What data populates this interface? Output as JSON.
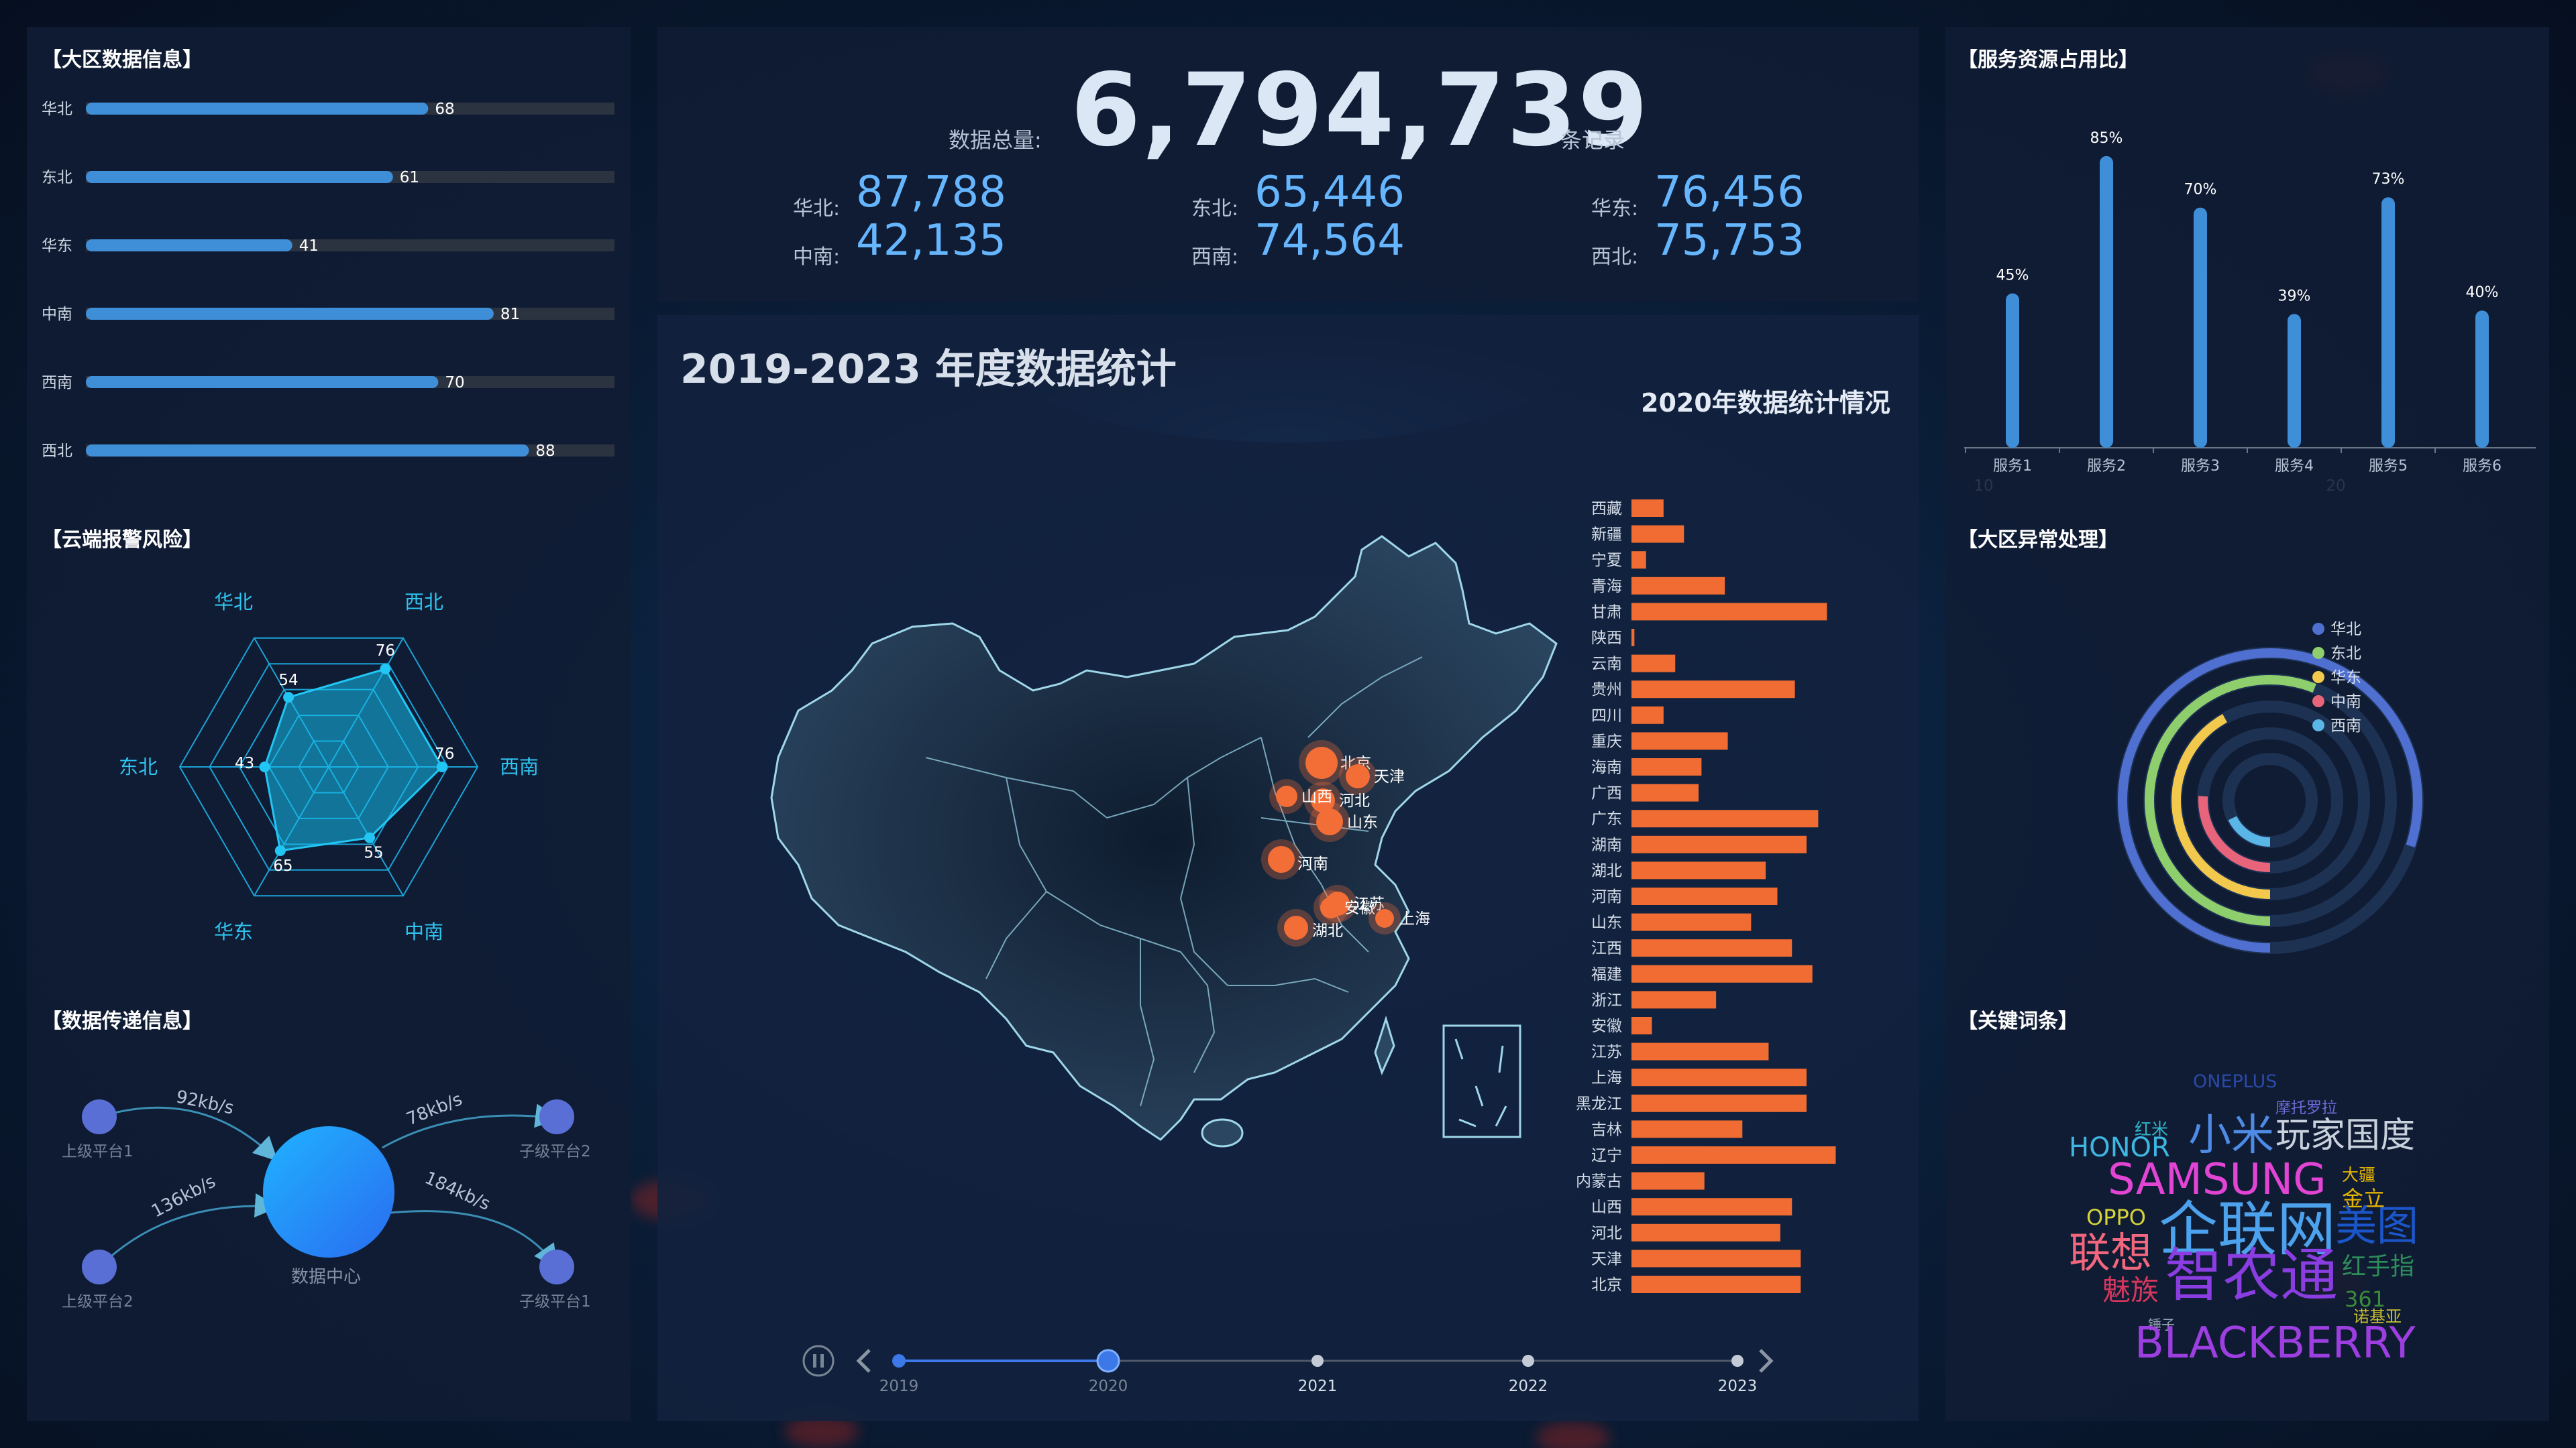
{
  "region_info": {
    "title": "【大区数据信息】",
    "chart_data": {
      "type": "bar",
      "orientation": "horizontal",
      "categories": [
        "华北",
        "东北",
        "华东",
        "中南",
        "西南",
        "西北"
      ],
      "values": [
        68,
        61,
        41,
        81,
        70,
        88
      ],
      "xlim": [
        0,
        105
      ]
    }
  },
  "cloud_risk": {
    "title": "【云端报警风险】",
    "chart_data": {
      "type": "radar",
      "indicators": [
        "华北",
        "西北",
        "西南",
        "中南",
        "华东",
        "东北"
      ],
      "values": [
        54,
        76,
        76,
        55,
        65,
        43
      ],
      "max": 100
    }
  },
  "data_transfer": {
    "title": "【数据传递信息】",
    "center_label": "数据中心",
    "nodes": [
      {
        "label": "上级平台1",
        "speed": "92kb/s"
      },
      {
        "label": "上级平台2",
        "speed": "136kb/s"
      },
      {
        "label": "子级平台2",
        "speed": "78kb/s"
      },
      {
        "label": "子级平台1",
        "speed": "184kb/s"
      }
    ]
  },
  "summary": {
    "total_label": "数据总量:",
    "total_value": "6,794,739",
    "total_unit": "条记录",
    "regions": [
      {
        "label": "华北:",
        "value": "87,788"
      },
      {
        "label": "东北:",
        "value": "65,446"
      },
      {
        "label": "华东:",
        "value": "76,456"
      },
      {
        "label": "中南:",
        "value": "42,135"
      },
      {
        "label": "西南:",
        "value": "74,564"
      },
      {
        "label": "西北:",
        "value": "75,753"
      }
    ]
  },
  "annual": {
    "title": "2019-2023 年度数据统计",
    "chart_title": "2020年数据统计情况",
    "map_points": [
      {
        "name": "北京"
      },
      {
        "name": "天津"
      },
      {
        "name": "河北"
      },
      {
        "name": "山西"
      },
      {
        "name": "山东"
      },
      {
        "name": "河南"
      },
      {
        "name": "江苏"
      },
      {
        "name": "安徽"
      },
      {
        "name": "上海"
      },
      {
        "name": "湖北"
      }
    ],
    "chart_data": {
      "type": "bar",
      "orientation": "horizontal",
      "categories": [
        "西藏",
        "新疆",
        "宁夏",
        "青海",
        "甘肃",
        "陕西",
        "云南",
        "贵州",
        "四川",
        "重庆",
        "海南",
        "广西",
        "广东",
        "湖南",
        "湖北",
        "河南",
        "山东",
        "江西",
        "福建",
        "浙江",
        "安徽",
        "江苏",
        "上海",
        "黑龙江",
        "吉林",
        "辽宁",
        "内蒙古",
        "山西",
        "河北",
        "天津",
        "北京"
      ],
      "values": [
        11,
        18,
        5,
        32,
        67,
        1,
        15,
        56,
        11,
        33,
        24,
        23,
        64,
        60,
        46,
        50,
        41,
        55,
        62,
        29,
        7,
        47,
        60,
        60,
        38,
        70,
        25,
        55,
        51,
        58,
        58
      ],
      "xticks": [
        10,
        20,
        30,
        40,
        50,
        60,
        70,
        80
      ],
      "xlim": [
        0,
        80
      ]
    },
    "timeline": {
      "years": [
        "2019",
        "2020",
        "2021",
        "2022",
        "2023"
      ],
      "current": "2020",
      "prev_icon": "chevron-left-icon",
      "next_icon": "chevron-right-icon",
      "play_icon": "pause-icon"
    }
  },
  "service_share": {
    "title": "【服务资源占用比】",
    "chart_data": {
      "type": "bar",
      "categories": [
        "服务1",
        "服务2",
        "服务3",
        "服务4",
        "服务5",
        "服务6"
      ],
      "values": [
        45,
        85,
        70,
        39,
        73,
        40
      ],
      "labels": [
        "45%",
        "85%",
        "70%",
        "39%",
        "73%",
        "40%"
      ],
      "ylim": [
        0,
        100
      ]
    }
  },
  "anomaly": {
    "title": "【大区异常处理】",
    "chart_data": {
      "type": "polar_bar",
      "series": [
        {
          "name": "华北",
          "color": "#4f6fd1",
          "value": 0.8
        },
        {
          "name": "东北",
          "color": "#8fce6c",
          "value": 0.56
        },
        {
          "name": "华东",
          "color": "#f2c94c",
          "value": 0.42
        },
        {
          "name": "中南",
          "color": "#e8647a",
          "value": 0.26
        },
        {
          "name": "西南",
          "color": "#5ab6e6",
          "value": 0.18
        }
      ]
    }
  },
  "keywords": {
    "title": "【关键词条】",
    "words": [
      {
        "text": "ONEPLUS",
        "color": "#2b49a8"
      },
      {
        "text": "摩托罗拉",
        "color": "#6d6bd8"
      },
      {
        "text": "红米",
        "color": "#2fb6c9"
      },
      {
        "text": "HONOR",
        "color": "#3fb5e2"
      },
      {
        "text": "小米",
        "color": "#4e8be6"
      },
      {
        "text": "玩家国度",
        "color": "#c9d1dc"
      },
      {
        "text": "SAMSUNG",
        "color": "#e244d4"
      },
      {
        "text": "大疆",
        "color": "#e6b400"
      },
      {
        "text": "金立",
        "color": "#e6b400"
      },
      {
        "text": "OPPO",
        "color": "#d6d33a"
      },
      {
        "text": "企联网",
        "color": "#4da2ee"
      },
      {
        "text": "美图",
        "color": "#1b56c9"
      },
      {
        "text": "联想",
        "color": "#f2677d"
      },
      {
        "text": "智农通",
        "color": "#8a3de0"
      },
      {
        "text": "红手指",
        "color": "#2e8d5a"
      },
      {
        "text": "魅族",
        "color": "#d7365d"
      },
      {
        "text": "361",
        "color": "#3a8a3a"
      },
      {
        "text": "锤子",
        "color": "#9aa6b6"
      },
      {
        "text": "诺基亚",
        "color": "#c9bf30"
      },
      {
        "text": "BLACKBERRY",
        "color": "#9d3fe0"
      }
    ]
  }
}
